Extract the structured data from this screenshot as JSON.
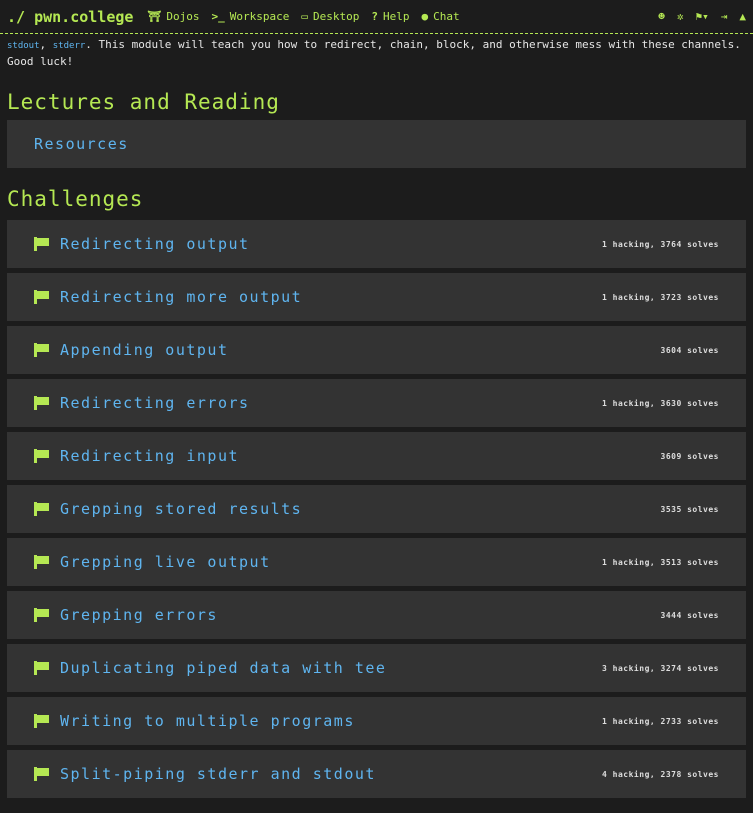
{
  "nav": {
    "brand": "./ pwn.college",
    "items": [
      {
        "icon": "torii-icon",
        "glyph": "⛩",
        "label": "Dojos"
      },
      {
        "icon": "terminal-icon",
        "glyph": ">_",
        "label": "Workspace"
      },
      {
        "icon": "desktop-icon",
        "glyph": "▭",
        "label": "Desktop"
      },
      {
        "icon": "question-icon",
        "glyph": "?",
        "label": "Help"
      },
      {
        "icon": "chat-icon",
        "glyph": "●",
        "label": "Chat"
      }
    ]
  },
  "intro": {
    "code1": "stdout",
    "sep": ", ",
    "code2": "stderr",
    "text": ". This module will teach you how to redirect, chain, block, and otherwise mess with these channels. Good luck!"
  },
  "lectures": {
    "heading": "Lectures and Reading",
    "items": [
      "Resources"
    ]
  },
  "challenges": {
    "heading": "Challenges",
    "items": [
      {
        "name": "Redirecting output",
        "stats": "1 hacking, 3764 solves"
      },
      {
        "name": "Redirecting more output",
        "stats": "1 hacking, 3723 solves"
      },
      {
        "name": "Appending output",
        "stats": "3604 solves"
      },
      {
        "name": "Redirecting errors",
        "stats": "1 hacking, 3630 solves"
      },
      {
        "name": "Redirecting input",
        "stats": "3609 solves"
      },
      {
        "name": "Grepping stored results",
        "stats": "3535 solves"
      },
      {
        "name": "Grepping live output",
        "stats": "1 hacking, 3513 solves"
      },
      {
        "name": "Grepping errors",
        "stats": "3444 solves"
      },
      {
        "name": "Duplicating piped data with tee",
        "stats": "3 hacking, 3274 solves"
      },
      {
        "name": "Writing to multiple programs",
        "stats": "1 hacking, 2733 solves"
      },
      {
        "name": "Split-piping stderr and stdout",
        "stats": "4 hacking, 2378 solves"
      }
    ]
  },
  "colors": {
    "accent": "#b5e853",
    "link": "#5fb5f0",
    "panel": "#333333"
  }
}
